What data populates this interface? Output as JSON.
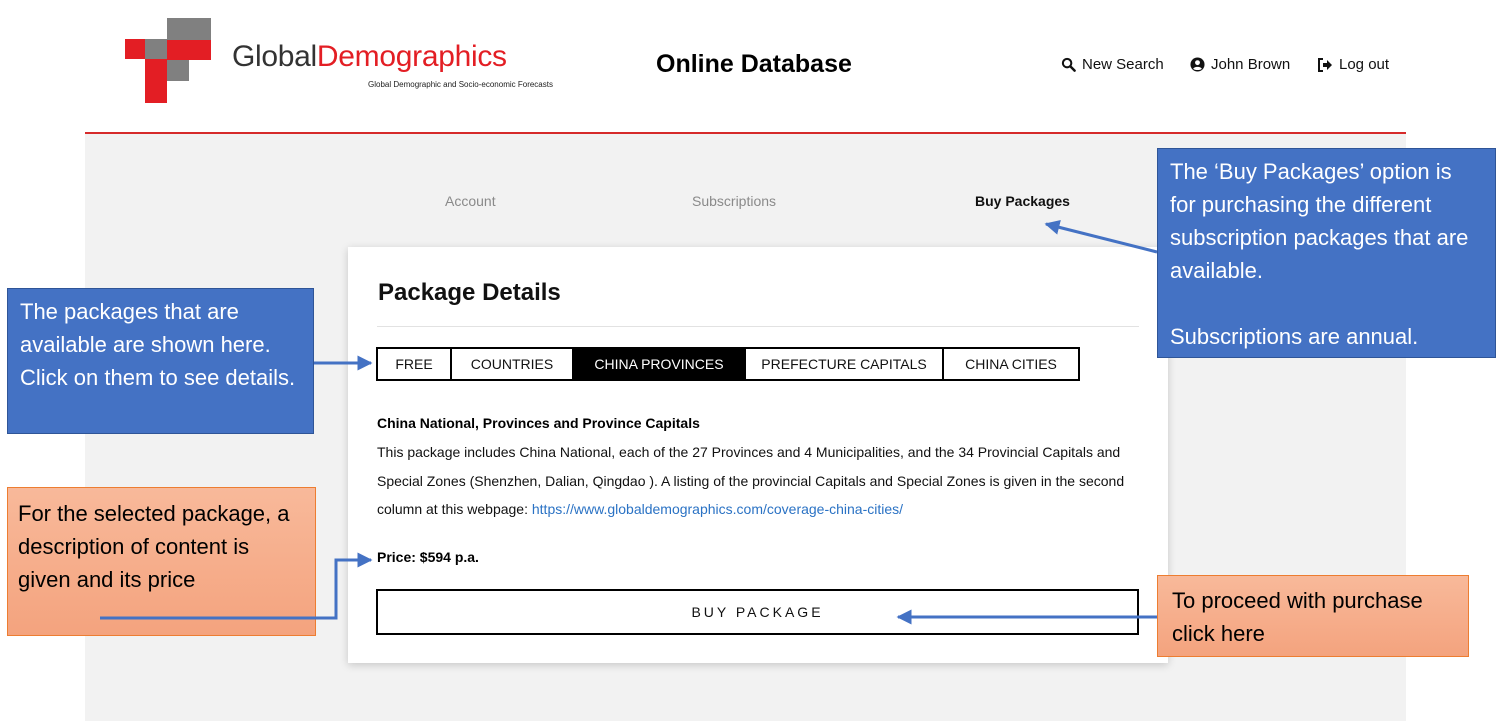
{
  "header": {
    "brand_part1": "Global",
    "brand_part2": "Demographics",
    "tagline": "Global Demographic and Socio-economic Forecasts",
    "db_title": "Online Database",
    "nav": {
      "search": {
        "label": "New Search",
        "icon": "search-icon"
      },
      "user": {
        "label": "John Brown",
        "icon": "user-icon"
      },
      "logout": {
        "label": "Log out",
        "icon": "logout-icon"
      }
    }
  },
  "account_tabs": {
    "account": "Account",
    "subscriptions": "Subscriptions",
    "buy_packages": "Buy Packages",
    "active": "Buy Packages"
  },
  "card": {
    "title": "Package Details",
    "package_tabs": [
      "FREE",
      "COUNTRIES",
      "CHINA PROVINCES",
      "PREFECTURE CAPITALS",
      "CHINA CITIES"
    ],
    "selected_tab": "CHINA PROVINCES",
    "package_name": "China National, Provinces and Province Capitals",
    "description": "This package includes China National, each of the 27 Provinces and 4 Municipalities, and the 34 Provincial Capitals and Special Zones (Shenzhen, Dalian, Qingdao ). A listing of the provincial Capitals and Special Zones is given in the second column at this webpage:",
    "link": "https://www.globaldemographics.com/coverage-china-cities/",
    "price": "Price: $594 p.a.",
    "buy_button": "BUY PACKAGE"
  },
  "callouts": {
    "buy_packages_line1": "The ‘Buy Packages’ option is for purchasing the different subscription packages that are available.",
    "buy_packages_line2": "Subscriptions are annual.",
    "packages": "The  packages that are available are shown here.  Click on them to see details.",
    "description": "For the selected package, a description of content is given and its price",
    "proceed": "To proceed with purchase click here"
  },
  "colors": {
    "brand_red": "#e31e24",
    "callout_blue": "#4472c4",
    "callout_orange": "#f4a37e",
    "link_blue": "#2a72c4"
  }
}
